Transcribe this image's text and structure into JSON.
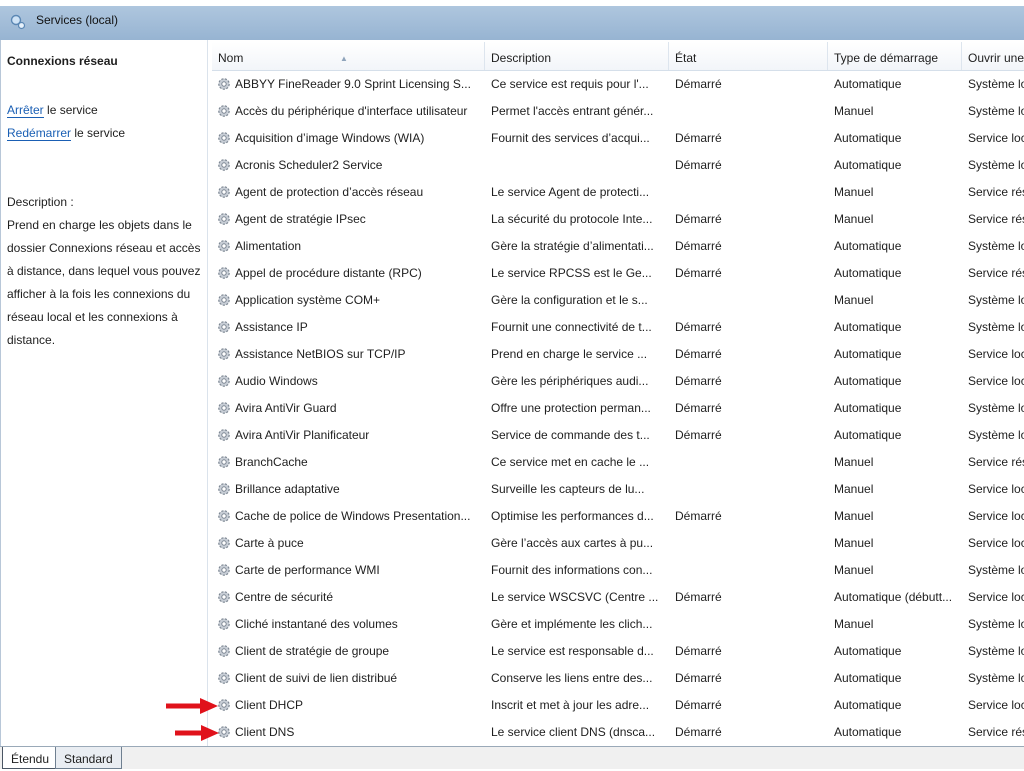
{
  "window": {
    "title": "Services (local)"
  },
  "left_pane": {
    "heading": "Connexions réseau",
    "actions": [
      {
        "link": "Arrêter",
        "rest": " le service"
      },
      {
        "link": "Redémarrer",
        "rest": " le service"
      }
    ],
    "description_label": "Description :",
    "description_text": "Prend en charge les objets dans le dossier Connexions réseau et accès à distance, dans lequel vous pouvez afficher à la fois les connexions du réseau local et les connexions à distance."
  },
  "columns": [
    "Nom",
    "Description",
    "État",
    "Type de démarrage",
    "Ouvrir une"
  ],
  "services": [
    {
      "name": "ABBYY FineReader 9.0 Sprint Licensing S...",
      "desc": "Ce service est requis pour l'...",
      "state": "Démarré",
      "startup": "Automatique",
      "logon": "Système lo"
    },
    {
      "name": "Accès du périphérique d'interface utilisateur",
      "desc": "Permet l'accès entrant génér...",
      "state": "",
      "startup": "Manuel",
      "logon": "Système lo"
    },
    {
      "name": "Acquisition d’image Windows (WIA)",
      "desc": "Fournit des services d’acqui...",
      "state": "Démarré",
      "startup": "Automatique",
      "logon": "Service loc"
    },
    {
      "name": "Acronis Scheduler2 Service",
      "desc": "",
      "state": "Démarré",
      "startup": "Automatique",
      "logon": "Système lo"
    },
    {
      "name": "Agent de protection d’accès réseau",
      "desc": "Le service Agent de protecti...",
      "state": "",
      "startup": "Manuel",
      "logon": "Service rés"
    },
    {
      "name": "Agent de stratégie IPsec",
      "desc": "La sécurité du protocole Inte...",
      "state": "Démarré",
      "startup": "Manuel",
      "logon": "Service rés"
    },
    {
      "name": "Alimentation",
      "desc": "Gère la stratégie d’alimentati...",
      "state": "Démarré",
      "startup": "Automatique",
      "logon": "Système lo"
    },
    {
      "name": "Appel de procédure distante (RPC)",
      "desc": "Le service RPCSS est le Ge...",
      "state": "Démarré",
      "startup": "Automatique",
      "logon": "Service rés"
    },
    {
      "name": "Application système COM+",
      "desc": "Gère la configuration et le s...",
      "state": "",
      "startup": "Manuel",
      "logon": "Système lo"
    },
    {
      "name": "Assistance IP",
      "desc": "Fournit une connectivité de t...",
      "state": "Démarré",
      "startup": "Automatique",
      "logon": "Système lo"
    },
    {
      "name": "Assistance NetBIOS sur TCP/IP",
      "desc": "Prend en charge le service ...",
      "state": "Démarré",
      "startup": "Automatique",
      "logon": "Service loc"
    },
    {
      "name": "Audio Windows",
      "desc": "Gère les périphériques audi...",
      "state": "Démarré",
      "startup": "Automatique",
      "logon": "Service loc"
    },
    {
      "name": "Avira AntiVir Guard",
      "desc": "Offre une protection perman...",
      "state": "Démarré",
      "startup": "Automatique",
      "logon": "Système lo"
    },
    {
      "name": "Avira AntiVir Planificateur",
      "desc": "Service de commande des t...",
      "state": "Démarré",
      "startup": "Automatique",
      "logon": "Système lo"
    },
    {
      "name": "BranchCache",
      "desc": "Ce service met en cache le ...",
      "state": "",
      "startup": "Manuel",
      "logon": "Service rés"
    },
    {
      "name": "Brillance adaptative",
      "desc": "Surveille les capteurs de lu...",
      "state": "",
      "startup": "Manuel",
      "logon": "Service loc"
    },
    {
      "name": "Cache de police de Windows Presentation...",
      "desc": "Optimise les performances d...",
      "state": "Démarré",
      "startup": "Manuel",
      "logon": "Service loc"
    },
    {
      "name": "Carte à puce",
      "desc": "Gère l’accès aux cartes à pu...",
      "state": "",
      "startup": "Manuel",
      "logon": "Service loc"
    },
    {
      "name": "Carte de performance WMI",
      "desc": "Fournit des informations con...",
      "state": "",
      "startup": "Manuel",
      "logon": "Système lo"
    },
    {
      "name": "Centre de sécurité",
      "desc": "Le service WSCSVC (Centre ...",
      "state": "Démarré",
      "startup": "Automatique (débutt...",
      "logon": "Service loc"
    },
    {
      "name": "Cliché instantané des volumes",
      "desc": "Gère et implémente les clich...",
      "state": "",
      "startup": "Manuel",
      "logon": "Système lo"
    },
    {
      "name": "Client de stratégie de groupe",
      "desc": "Le service est responsable d...",
      "state": "Démarré",
      "startup": "Automatique",
      "logon": "Système lo"
    },
    {
      "name": "Client de suivi de lien distribué",
      "desc": "Conserve les liens entre des...",
      "state": "Démarré",
      "startup": "Automatique",
      "logon": "Système lo"
    },
    {
      "name": "Client DHCP",
      "desc": "Inscrit et met à jour les adre...",
      "state": "Démarré",
      "startup": "Automatique",
      "logon": "Service loc"
    },
    {
      "name": "Client DNS",
      "desc": "Le service client DNS (dnsca...",
      "state": "Démarré",
      "startup": "Automatique",
      "logon": "Service rés"
    }
  ],
  "tabs": [
    "Étendu",
    "Standard"
  ],
  "colors": {
    "arrow": "#e0121b",
    "link": "#1a5fb4",
    "title_bar": "#a6c0dc"
  }
}
